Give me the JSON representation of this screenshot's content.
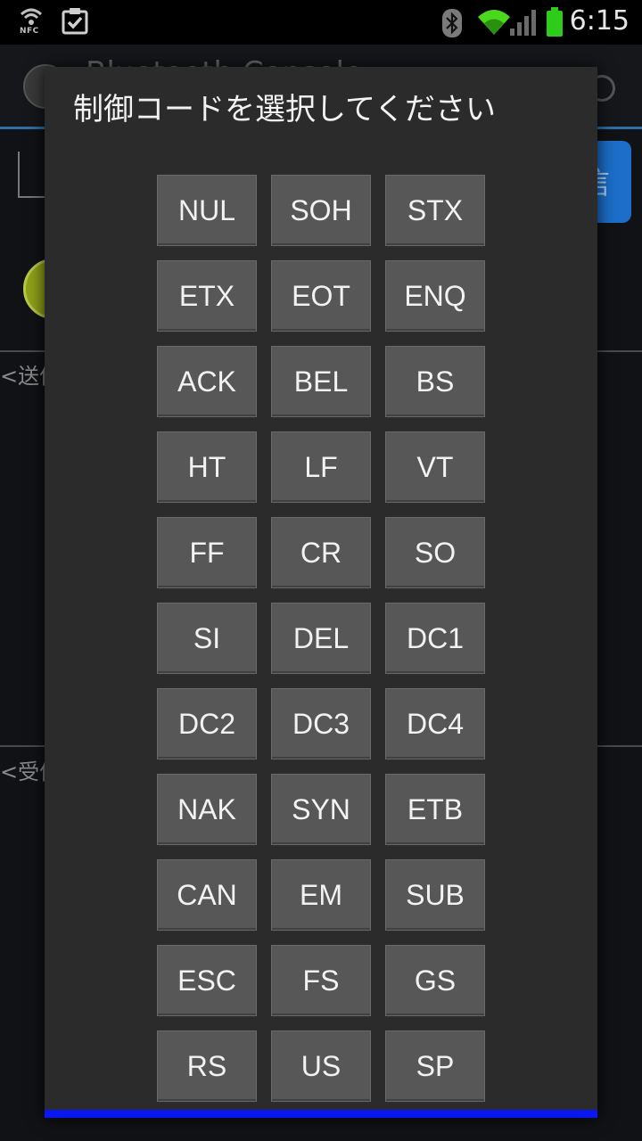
{
  "status_bar": {
    "time": "6:15",
    "nfc_label": "NFC",
    "icons": [
      "nfc-icon",
      "clipboard-check-icon",
      "bluetooth-icon",
      "wifi-icon",
      "signal-icon",
      "battery-icon"
    ],
    "battery_color": "#2ecc1a",
    "wifi_color": "#4ad81c"
  },
  "background_app": {
    "title": "Bluetooth Console",
    "send_button_label": "信",
    "send_area_label": "<送信",
    "receive_area_label": "<受信",
    "accent_color": "#1c6ec8"
  },
  "dialog": {
    "title": "制御コードを選択してください",
    "accent_bar_color": "#0a18f0",
    "codes": [
      "NUL",
      "SOH",
      "STX",
      "ETX",
      "EOT",
      "ENQ",
      "ACK",
      "BEL",
      "BS",
      "HT",
      "LF",
      "VT",
      "FF",
      "CR",
      "SO",
      "SI",
      "DEL",
      "DC1",
      "DC2",
      "DC3",
      "DC4",
      "NAK",
      "SYN",
      "ETB",
      "CAN",
      "EM",
      "SUB",
      "ESC",
      "FS",
      "GS",
      "RS",
      "US",
      "SP"
    ]
  }
}
